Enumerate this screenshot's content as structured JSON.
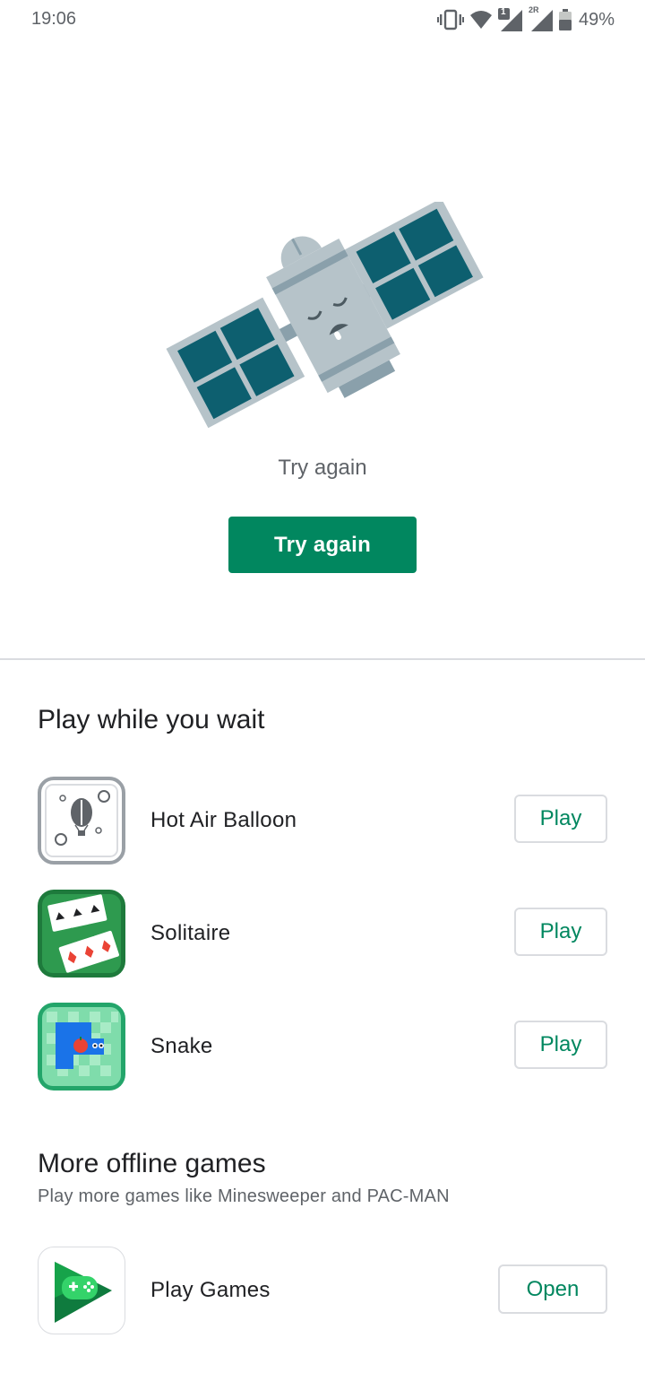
{
  "status_bar": {
    "time": "19:06",
    "sim1_badge": "1",
    "sim2_badge": "2R",
    "battery_percent": "49%",
    "icons": [
      "vibrate-icon",
      "wifi-icon",
      "signal-sim1-icon",
      "signal-sim2-icon",
      "battery-icon"
    ]
  },
  "error": {
    "message": "Try again",
    "button_label": "Try again",
    "illustration": "sleeping-satellite"
  },
  "play_while_wait": {
    "title": "Play while you wait",
    "games": [
      {
        "name": "Hot Air Balloon",
        "action": "Play",
        "icon": "hot-air-balloon-icon"
      },
      {
        "name": "Solitaire",
        "action": "Play",
        "icon": "solitaire-icon"
      },
      {
        "name": "Snake",
        "action": "Play",
        "icon": "snake-icon"
      }
    ]
  },
  "more_offline": {
    "title": "More offline games",
    "subtitle": "Play more games like Minesweeper and PAC-MAN",
    "apps": [
      {
        "name": "Play Games",
        "action": "Open",
        "icon": "play-games-icon"
      }
    ]
  },
  "colors": {
    "accent": "#01875f",
    "divider": "#dadce0",
    "text_primary": "#202124",
    "text_secondary": "#5f6368"
  }
}
